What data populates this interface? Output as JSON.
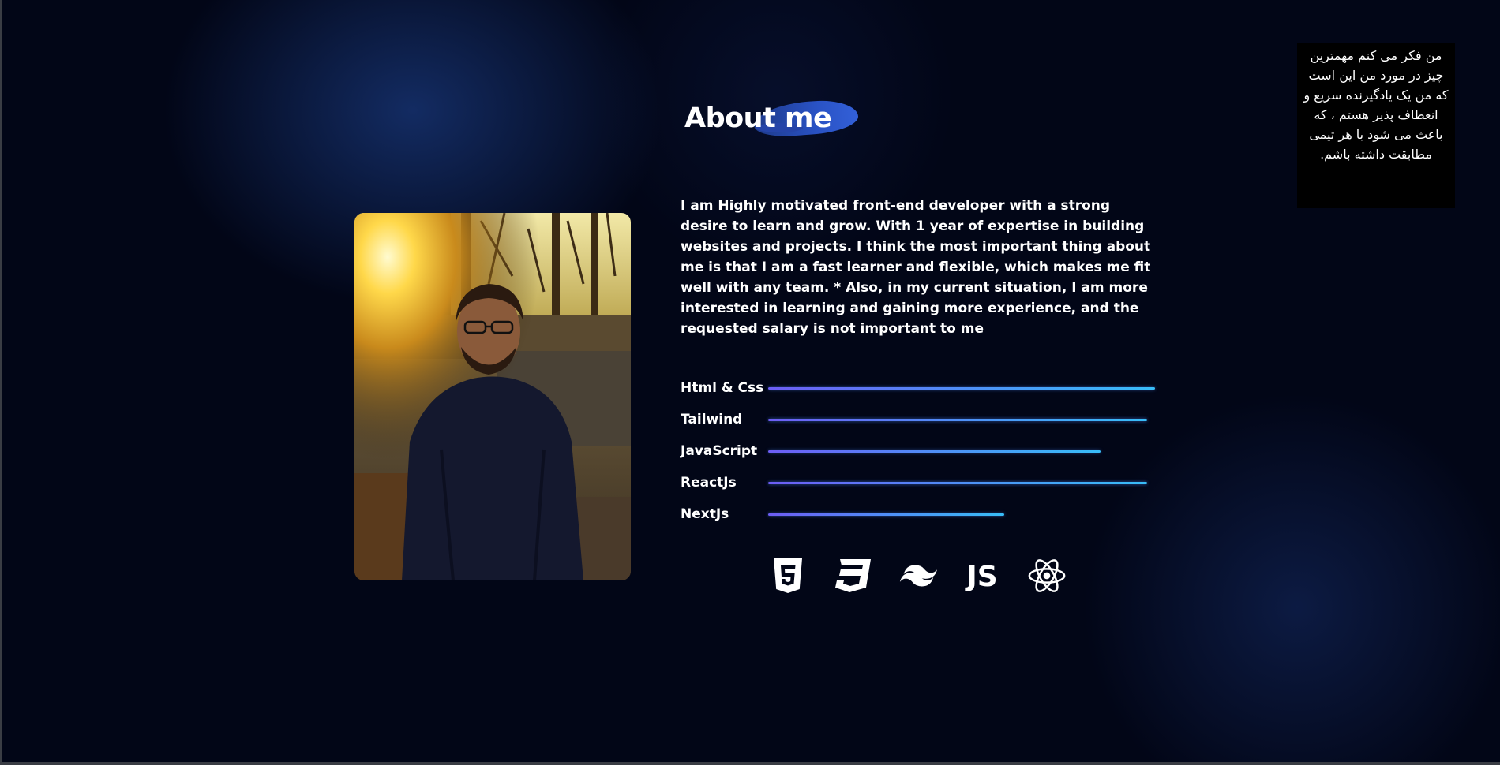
{
  "about": {
    "title": "About me",
    "description": "I am Highly motivated front-end developer with a strong desire to learn and grow. With 1 year of expertise in building websites and projects. I think the most important thing about me is that I am a fast learner and flexible, which makes me fit well with any team. * Also, in my current situation, I am more interested in learning and gaining more experience, and the requested salary is not important to me"
  },
  "skills": [
    {
      "name": "Html & Css",
      "level": 1.0
    },
    {
      "name": "Tailwind",
      "level": 0.98
    },
    {
      "name": "JavaScript",
      "level": 0.86
    },
    {
      "name": "ReactJs",
      "level": 0.98
    },
    {
      "name": "NextJs",
      "level": 0.61
    }
  ],
  "tech_icons": [
    "html5-icon",
    "css3-icon",
    "tailwind-icon",
    "javascript-icon",
    "react-icon"
  ],
  "note": {
    "text": "من فکر می کنم مهمترین چیز در مورد من این است که من یک یادگیرنده سریع و انعطاف پذیر هستم ، که باعث می شود با هر تیمی مطابقت داشته باشم."
  },
  "colors": {
    "background": "#020617",
    "accent_blob": "#2952c4",
    "skill_gradient_start": "#6d5df5",
    "skill_gradient_end": "#38bdf8"
  }
}
